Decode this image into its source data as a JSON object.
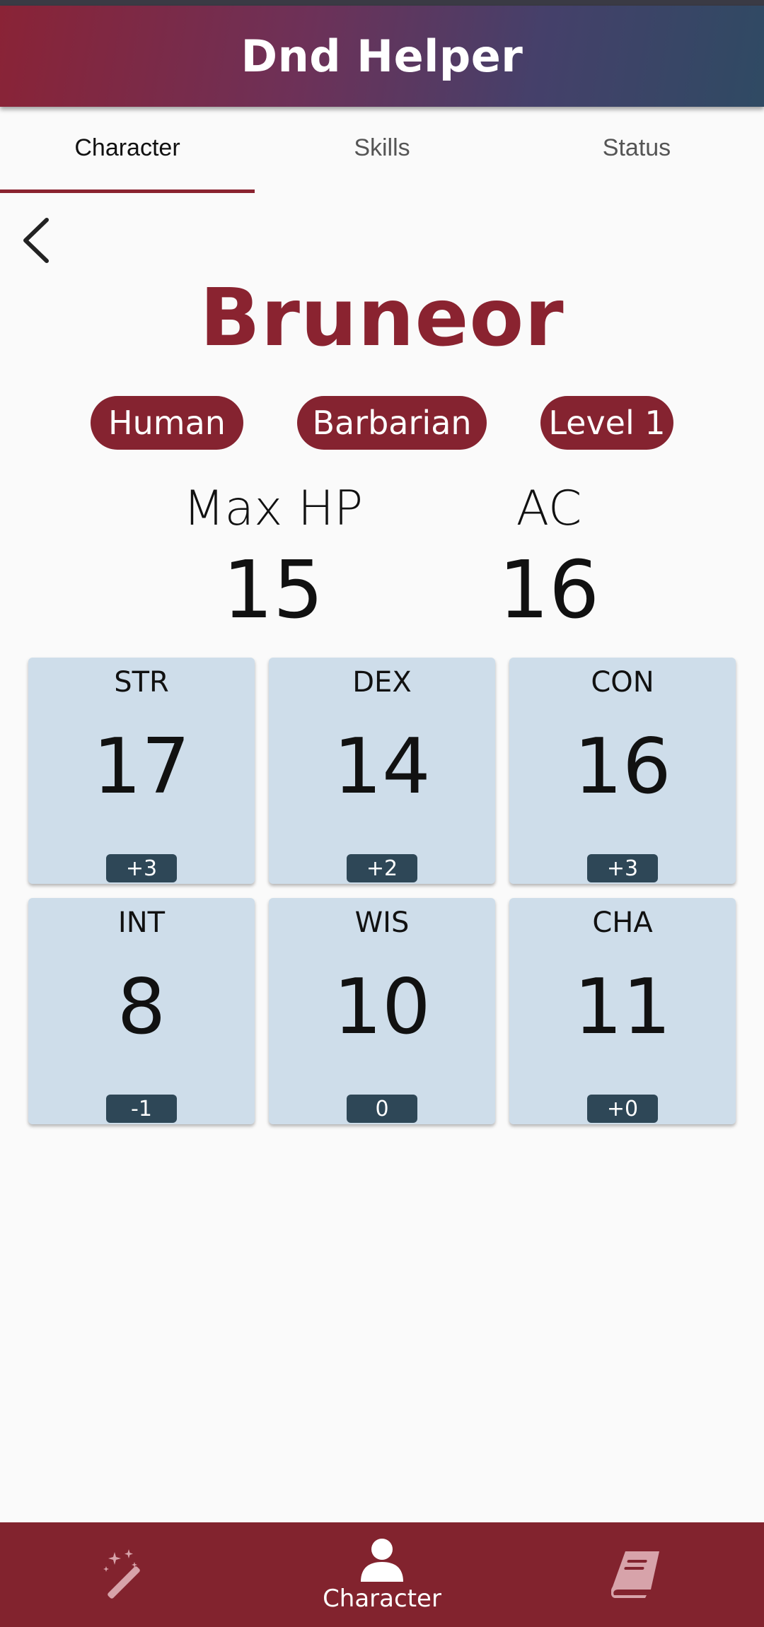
{
  "app": {
    "title": "Dnd Helper"
  },
  "tabs": [
    {
      "label": "Character",
      "active": true
    },
    {
      "label": "Skills",
      "active": false
    },
    {
      "label": "Status",
      "active": false
    }
  ],
  "character": {
    "name": "Bruneor",
    "race": "Human",
    "class": "Barbarian",
    "level": "Level 1",
    "max_hp_label": "Max HP",
    "max_hp": "15",
    "ac_label": "AC",
    "ac": "16"
  },
  "abilities": [
    {
      "name": "STR",
      "score": "17",
      "modifier": "+3"
    },
    {
      "name": "DEX",
      "score": "14",
      "modifier": "+2"
    },
    {
      "name": "CON",
      "score": "16",
      "modifier": "+3"
    },
    {
      "name": "INT",
      "score": "8",
      "modifier": "-1"
    },
    {
      "name": "WIS",
      "score": "10",
      "modifier": "0"
    },
    {
      "name": "CHA",
      "score": "11",
      "modifier": "+0"
    }
  ],
  "bottom_nav": [
    {
      "icon": "magic-wand-icon",
      "label": "",
      "active": false
    },
    {
      "icon": "person-icon",
      "label": "Character",
      "active": true
    },
    {
      "icon": "book-icon",
      "label": "",
      "active": false
    }
  ],
  "colors": {
    "accent": "#8a2330",
    "card_bg": "#ceddea",
    "modifier_bg": "#2e4757",
    "nav_bg": "#82232e"
  }
}
